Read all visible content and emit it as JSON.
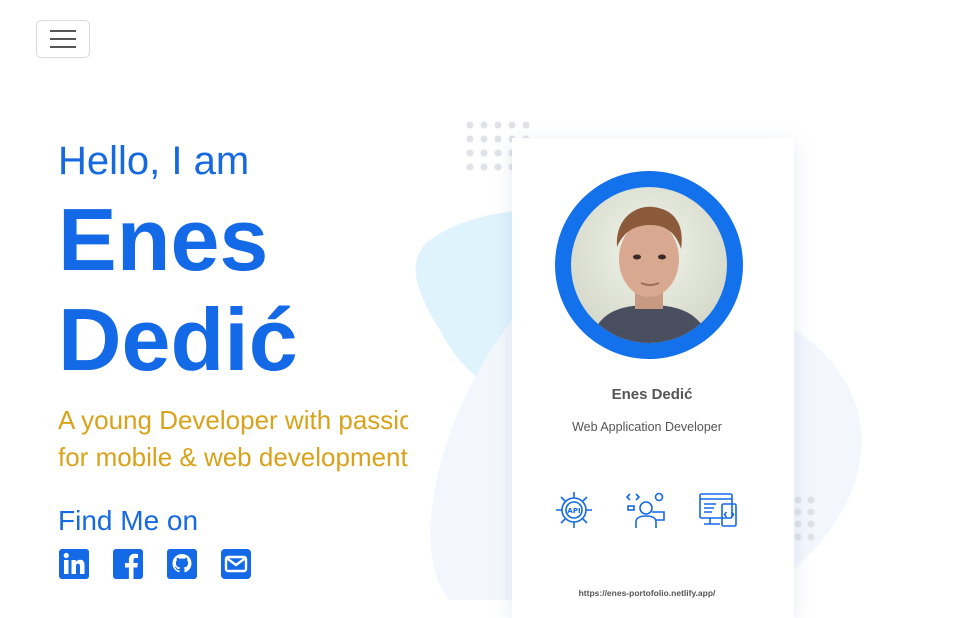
{
  "navbar": {
    "toggle_icon": "hamburger-icon"
  },
  "hero": {
    "greeting": "Hello, I am",
    "first_name": "Enes",
    "last_name": "Dedić",
    "tagline_line1": "A young Developer with passion",
    "tagline_line2": "for mobile & web development",
    "find_me": "Find Me on",
    "socials": [
      "linkedin-icon",
      "facebook-icon",
      "github-icon",
      "email-icon"
    ]
  },
  "card": {
    "name": "Enes Dedić",
    "role": "Web Application Developer",
    "url": "https://enes-portofolio.netlify.app/",
    "icons": [
      "api-gear-icon",
      "developer-icon",
      "web-code-icon"
    ]
  },
  "colors": {
    "primary": "#1469e6",
    "accent": "#d9a21b",
    "blob": "#e0f3fd"
  }
}
